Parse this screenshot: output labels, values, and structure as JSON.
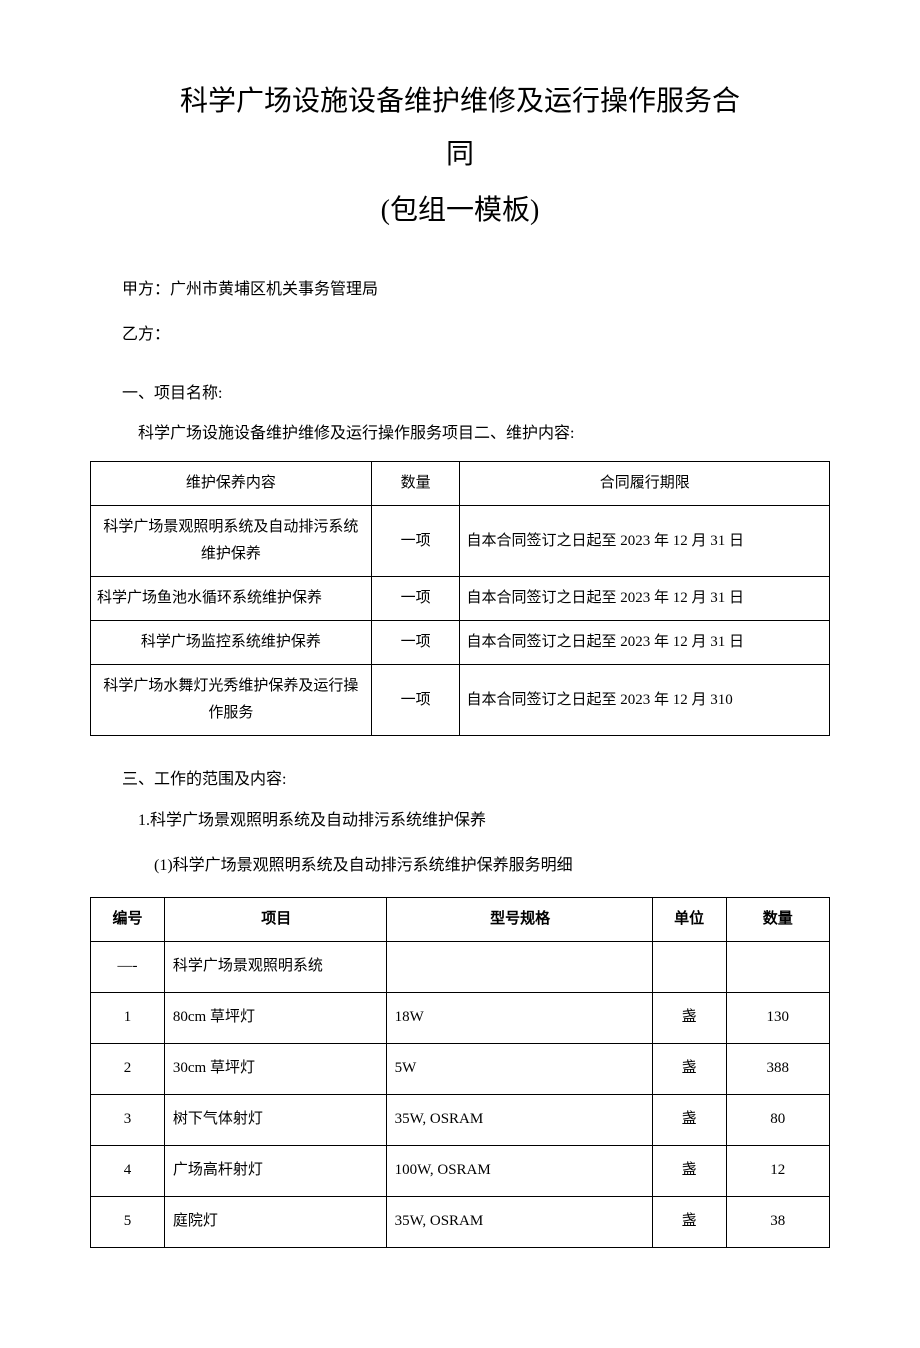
{
  "title_line1": "科学广场设施设备维护维修及运行操作服务合",
  "title_line2": "同",
  "subtitle": "(包组一模板)",
  "party_a_label": "甲方：",
  "party_a_value": "广州市黄埔区机关事务管理局",
  "party_b_label": "乙方：",
  "party_b_value": "",
  "section1_heading": "一、项目名称:",
  "section1_text": "科学广场设施设备维护维修及运行操作服务项目二、维护内容:",
  "table1": {
    "headers": [
      "维护保养内容",
      "数量",
      "合同履行期限"
    ],
    "rows": [
      {
        "content": "科学广场景观照明系统及自动排污系统维护保养",
        "qty": "一项",
        "period": "自本合同签订之日起至 2023 年 12 月 31 日"
      },
      {
        "content": "科学广场鱼池水循环系统维护保养",
        "qty": "一项",
        "period": "自本合同签订之日起至 2023 年 12 月 31 日"
      },
      {
        "content": "科学广场监控系统维护保养",
        "qty": "一项",
        "period": "自本合同签订之日起至 2023 年 12 月 31 日"
      },
      {
        "content": "科学广场水舞灯光秀维护保养及运行操作服务",
        "qty": "一项",
        "period": "自本合同签订之日起至 2023 年 12 月 310"
      }
    ]
  },
  "section3_heading": "三、工作的范围及内容:",
  "section3_sub1": "1.科学广场景观照明系统及自动排污系统维护保养",
  "section3_sub1_1": "(1)科学广场景观照明系统及自动排污系统维护保养服务明细",
  "table2": {
    "headers": [
      "编号",
      "项目",
      "型号规格",
      "单位",
      "数量"
    ],
    "rows": [
      {
        "no": "—-",
        "item": "科学广场景观照明系统",
        "spec": "",
        "unit": "",
        "qty": ""
      },
      {
        "no": "1",
        "item": "80cm 草坪灯",
        "spec": "18W",
        "unit": "盏",
        "qty": "130"
      },
      {
        "no": "2",
        "item": "30cm 草坪灯",
        "spec": "5W",
        "unit": "盏",
        "qty": "388"
      },
      {
        "no": "3",
        "item": "树下气体射灯",
        "spec": "35W, OSRAM",
        "unit": "盏",
        "qty": "80"
      },
      {
        "no": "4",
        "item": "广场高杆射灯",
        "spec": "100W, OSRAM",
        "unit": "盏",
        "qty": "12"
      },
      {
        "no": "5",
        "item": "庭院灯",
        "spec": "35W, OSRAM",
        "unit": "盏",
        "qty": "38"
      }
    ]
  }
}
